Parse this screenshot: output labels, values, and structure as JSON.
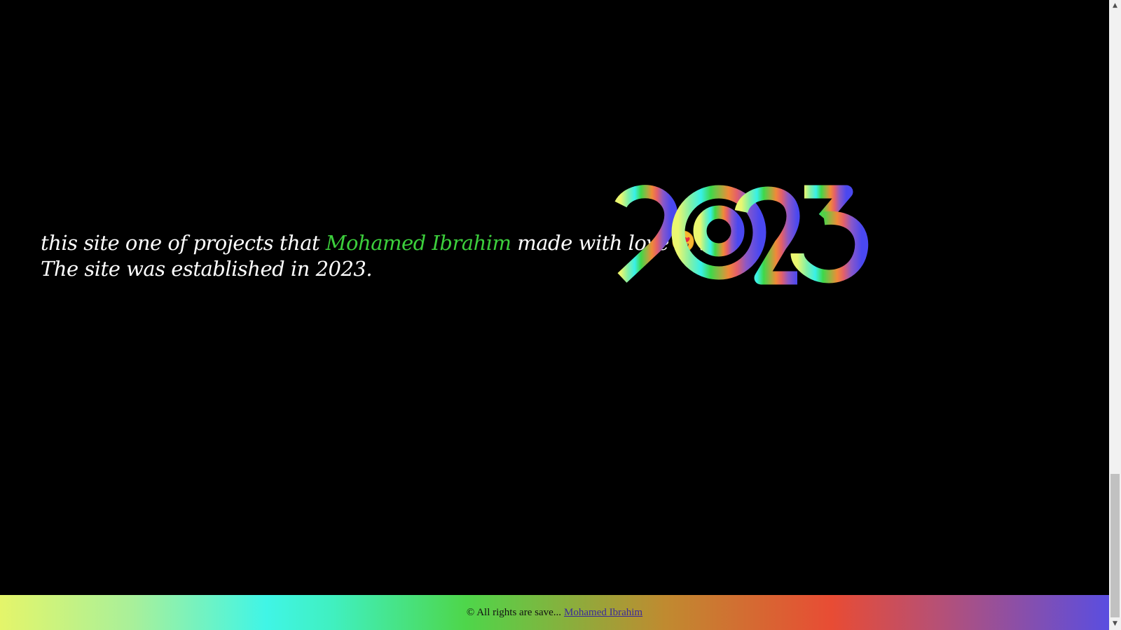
{
  "about": {
    "line1_prefix": "this site one of projects that ",
    "author_name": "Mohamed Ibrahim",
    "line1_suffix": " made with love",
    "line1_end": ".",
    "line2": "The site was established in 2023."
  },
  "emoji": {
    "icon": "heart-eyes-emoji-icon"
  },
  "logo": {
    "text": "2023",
    "icon": "year-2023-gradient-logo"
  },
  "footer": {
    "copyright": "© All rights are save...",
    "author_link": "Mohamed Ibrahim"
  },
  "scrollbar": {
    "up_arrow": "▲",
    "down_arrow": "▼"
  },
  "colors": {
    "background": "#000000",
    "text": "#ffffff",
    "author_name": "#3ccf3c",
    "footer_link": "#3a2a9a"
  }
}
